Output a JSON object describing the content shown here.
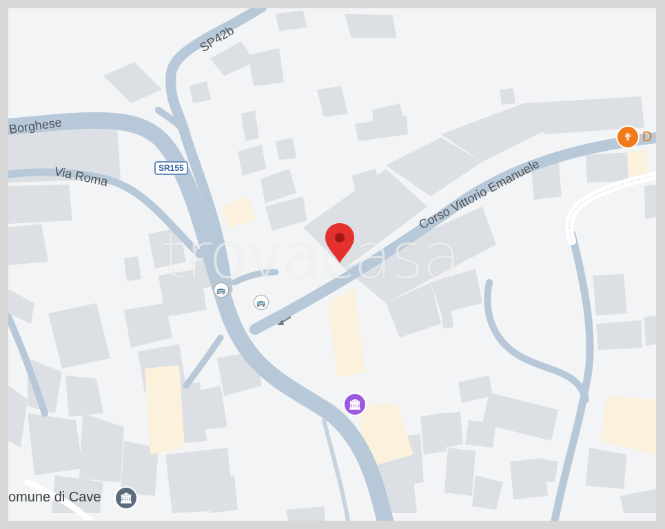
{
  "map": {
    "roads": {
      "borghese": "Borghese",
      "via_roma": "Via Roma",
      "corso": "Corso Vittorio Emanuele",
      "sp42b": "SP42b",
      "sr155": "SR155"
    },
    "places": {
      "comune": "omune di Cave",
      "restaurant_partial": "D"
    },
    "watermark": "trovacasa",
    "icons": {
      "pin": "location-pin-icon",
      "restaurant": "fork-knife-icon",
      "museum": "museum-icon",
      "townhall": "townhall-icon",
      "bus": "bus-stop-icon"
    },
    "colors": {
      "background": "#f3f4f5",
      "road": "#b7c9d8",
      "building": "#dcdfe3",
      "highlight_building": "#fbf1dd",
      "pin": "#e5312d",
      "restaurant": "#f07a18",
      "museum": "#9b5ae0",
      "townhall": "#5b6b7c"
    }
  }
}
